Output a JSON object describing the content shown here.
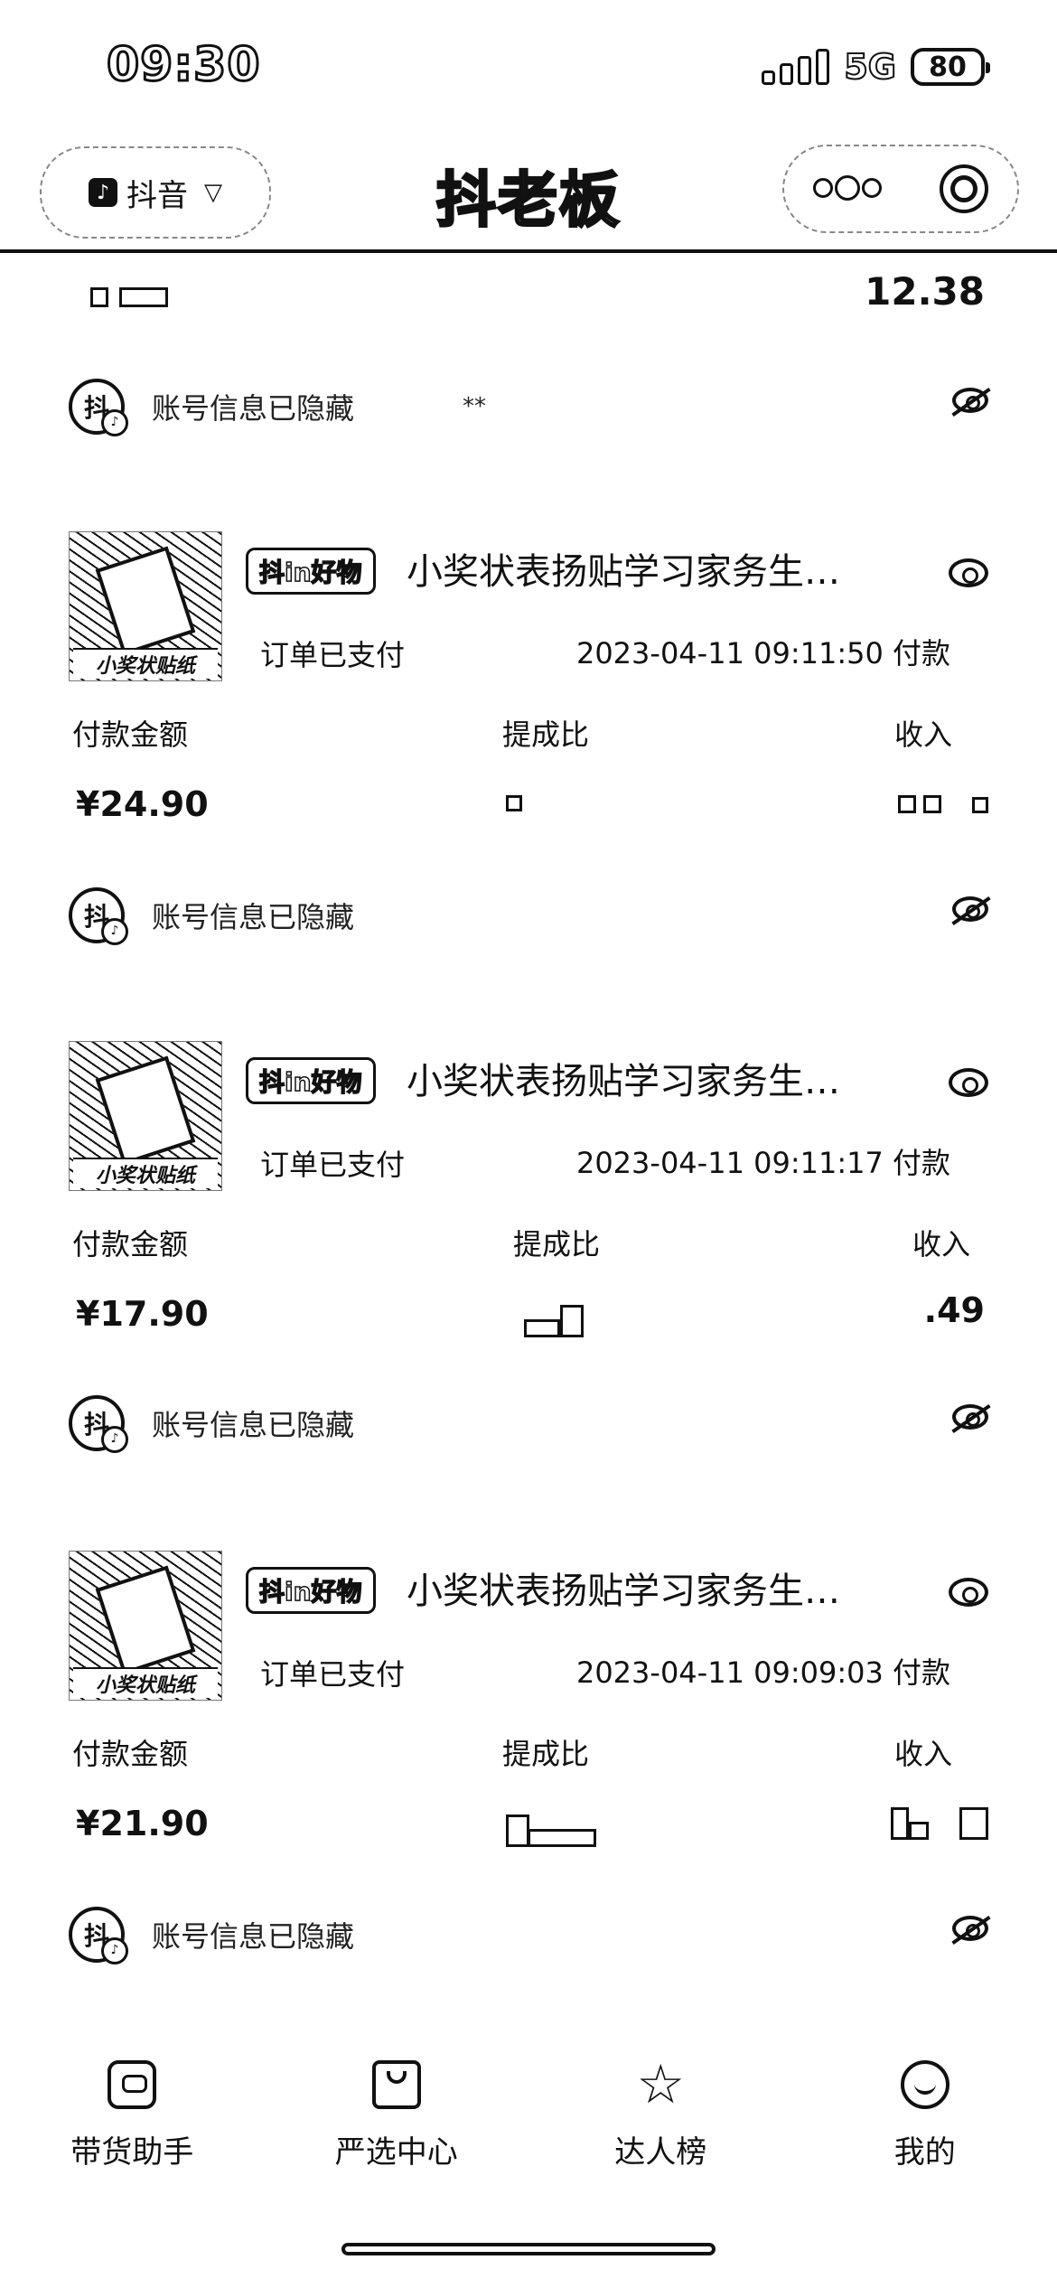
{
  "status_bar": {
    "time": "09:30",
    "network": "5G",
    "battery": "80"
  },
  "header": {
    "app_name": "抖音",
    "title": "抖老板"
  },
  "partial_row": {
    "right_value": "12.38"
  },
  "account_info": {
    "label": "账号信息已隐藏",
    "mask": "**"
  },
  "orders": [
    {
      "badge": "抖in好物",
      "title": "小奖状表扬贴学习家务生…",
      "thumb_label": "小奖状贴纸",
      "status": "订单已支付",
      "time": "2023-04-11 09:11:50 付款",
      "amount_label": "付款金额",
      "amount": "¥24.90",
      "ratio_label": "提成比",
      "income_label": "收入",
      "income": ""
    },
    {
      "badge": "抖in好物",
      "title": "小奖状表扬贴学习家务生…",
      "thumb_label": "小奖状贴纸",
      "status": "订单已支付",
      "time": "2023-04-11 09:11:17 付款",
      "amount_label": "付款金额",
      "amount": "¥17.90",
      "ratio_label": "提成比",
      "income_label": "收入",
      "income": ".49"
    },
    {
      "badge": "抖in好物",
      "title": "小奖状表扬贴学习家务生…",
      "thumb_label": "小奖状贴纸",
      "status": "订单已支付",
      "time": "2023-04-11 09:09:03 付款",
      "amount_label": "付款金额",
      "amount": "¥21.90",
      "ratio_label": "提成比",
      "income_label": "收入",
      "income": ""
    }
  ],
  "bottom_nav": [
    {
      "label": "带货助手",
      "icon": "receipt-icon"
    },
    {
      "label": "严选中心",
      "icon": "shopping-bag-icon"
    },
    {
      "label": "达人榜",
      "icon": "star-icon"
    },
    {
      "label": "我的",
      "icon": "smile-icon"
    }
  ]
}
